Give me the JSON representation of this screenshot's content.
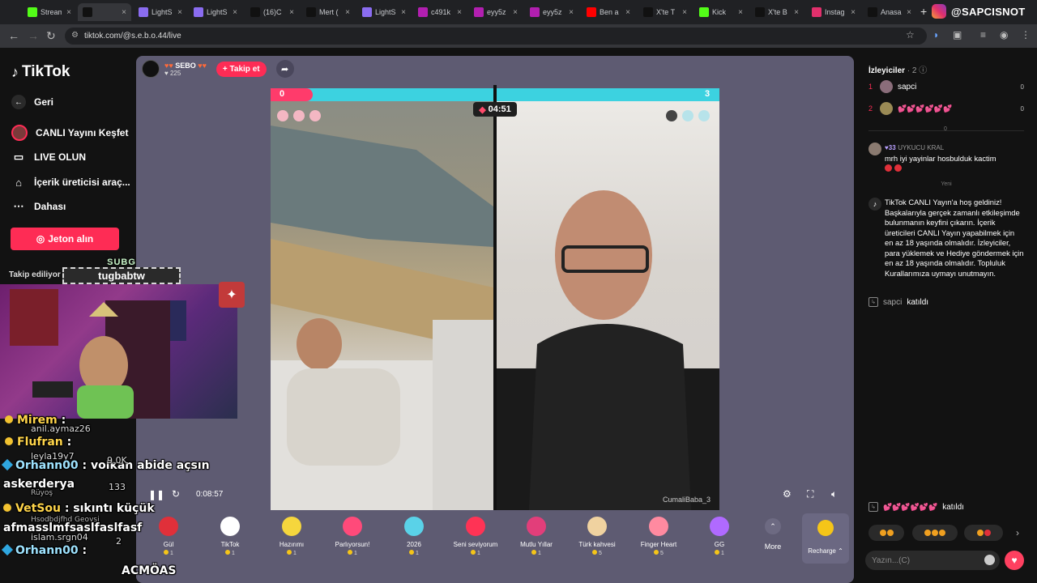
{
  "browser": {
    "tabs": [
      {
        "title": "Stream",
        "icon": "kick-icon",
        "color": "#53fc18"
      },
      {
        "title": "",
        "icon": "tiktok-icon",
        "color": "#111111",
        "active": true
      },
      {
        "title": "LightS",
        "icon": "lightshot-icon",
        "color": "#8a6cf0"
      },
      {
        "title": "LightS",
        "icon": "lightshot-icon",
        "color": "#8a6cf0"
      },
      {
        "title": "(16)C",
        "icon": "tiktok-icon",
        "color": "#111111"
      },
      {
        "title": "Mert (",
        "icon": "tiktok-icon",
        "color": "#111111"
      },
      {
        "title": "LightS",
        "icon": "lightshot-icon",
        "color": "#8a6cf0"
      },
      {
        "title": "c491k",
        "icon": "twitch-icon",
        "color": "#b21fb0"
      },
      {
        "title": "eyy5z",
        "icon": "twitch-icon",
        "color": "#b21fb0"
      },
      {
        "title": "eyy5z",
        "icon": "twitch-icon",
        "color": "#b21fb0"
      },
      {
        "title": "Ben a",
        "icon": "youtube-icon",
        "color": "#ff0000"
      },
      {
        "title": "X'te T",
        "icon": "x-icon",
        "color": "#111111"
      },
      {
        "title": "Kick",
        "icon": "kick-icon",
        "color": "#53fc18"
      },
      {
        "title": "X'te B",
        "icon": "x-icon",
        "color": "#111111"
      },
      {
        "title": "Instag",
        "icon": "instagram-icon",
        "color": "#e1306c"
      },
      {
        "title": "Anasa",
        "icon": "x-icon",
        "color": "#111111"
      }
    ],
    "url": "tiktok.com/@s.e.b.o.44/live",
    "brand": "@SAPCISNOT"
  },
  "nav": {
    "logo": "TikTok",
    "items": [
      {
        "label": "Geri",
        "icon": "back-arrow-icon"
      },
      {
        "label": "CANLI Yayını Keşfet",
        "icon": "live-avatar-icon"
      },
      {
        "label": "LIVE OLUN",
        "icon": "video-camera-icon"
      },
      {
        "label": "İçerik üreticisi araç...",
        "icon": "lightbulb-icon"
      },
      {
        "label": "Dahası",
        "icon": "more-dots-icon"
      }
    ],
    "jeton": "Jeton alın",
    "following": "Takip ediliyor"
  },
  "host": {
    "name": "SEBO",
    "likes": "225",
    "follow": "+ Takip et"
  },
  "battle": {
    "left_score": "0",
    "right_score": "3",
    "timer": "04:51",
    "right_caption": "CumaliBaba_3",
    "elapsed": "0:08:57"
  },
  "gifts": [
    {
      "name": "Gül",
      "price": "1",
      "color": "#e0303a"
    },
    {
      "name": "TikTok",
      "price": "1",
      "color": "#ffffff"
    },
    {
      "name": "Hazırımı",
      "price": "1",
      "color": "#f5d63d"
    },
    {
      "name": "Parlıyorsun!",
      "price": "1",
      "color": "#ff4a7a"
    },
    {
      "name": "2026",
      "price": "1",
      "color": "#5ad2e8"
    },
    {
      "name": "Seni seviyorum",
      "price": "1",
      "color": "#ff3355"
    },
    {
      "name": "Mutlu Yıllar",
      "price": "1",
      "color": "#e23e7a"
    },
    {
      "name": "Türk kahvesi",
      "price": "5",
      "color": "#f0d2a0"
    },
    {
      "name": "Finger Heart",
      "price": "5",
      "color": "#ff8aa0"
    },
    {
      "name": "GG",
      "price": "1",
      "color": "#b06aff"
    }
  ],
  "more": "More",
  "recharge": "Recharge",
  "panel": {
    "title": "İzleyiciler",
    "count": "· 2",
    "viewers": [
      {
        "rank": "1",
        "name": "sapci",
        "score": "0"
      },
      {
        "rank": "2",
        "name": "💕💕💕💕💕💕",
        "score": "0"
      }
    ],
    "divider_label": "0",
    "new_label": "Yeni",
    "chat": [
      {
        "badge": "33",
        "user": "UYKUCU KRAL",
        "text": "mrh iyi yayinlar hosbulduk kactim"
      },
      {
        "badge": "",
        "user": "",
        "text": "TikTok CANLI Yayın'a hoş geldiniz! Başkalarıyla gerçek zamanlı etkileşimde bulunmanın keyfini çıkarın. İçerik üreticileri CANLI Yayın yapabilmek için en az 18 yaşında olmalıdır. İzleyiciler, para yüklemek ve Hediye göndermek için en az 18 yaşında olmalıdır. Topluluk Kurallarımıza uymayı unutmayın."
      }
    ],
    "joined1_user": "sapci",
    "joined_label": "katıldı",
    "joined2_user": "💕💕💕💕💕💕",
    "input_placeholder": "Yazın...(C)"
  },
  "overlay": {
    "cam_top": "SUBG",
    "cam_name": "tugbabtw",
    "lines": [
      {
        "user": "Mirem",
        "text": ":"
      },
      {
        "user": "anil.aymaz26",
        "text": ""
      },
      {
        "user": "Flufran",
        "text": ":"
      },
      {
        "user": "leyla19y7",
        "text": ""
      },
      {
        "user": "Orhann00",
        "text": ": volkan abide açsın"
      },
      {
        "user": "askerderya",
        "text": ""
      },
      {
        "user": "Rüyoş",
        "text": ""
      },
      {
        "user": "VetSou",
        "text": ": sıkıntı küçük"
      },
      {
        "user": "Hsodbdjfhd Geovsi",
        "text": ""
      },
      {
        "user": "afmasslmfsaslfaslfasf",
        "text": ""
      },
      {
        "user": "islam.srgn04",
        "text": ""
      },
      {
        "user": "Orhann00",
        "text": ":"
      },
      {
        "user": "ACMÖAS",
        "text": ""
      }
    ],
    "side_numbers": [
      "9.0K",
      "133",
      "2"
    ]
  }
}
